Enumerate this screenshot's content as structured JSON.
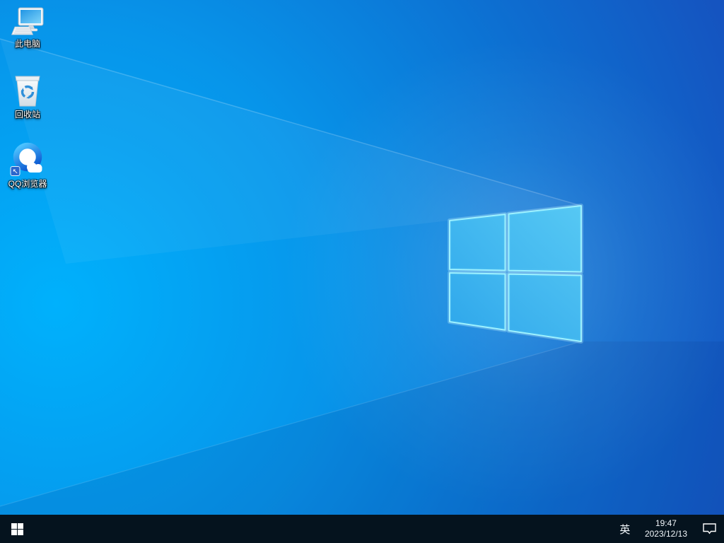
{
  "desktop": {
    "icons": [
      {
        "name": "this-pc",
        "label": "此电脑"
      },
      {
        "name": "recycle-bin",
        "label": "回收站"
      },
      {
        "name": "qq-browser",
        "label": "QQ浏览器"
      }
    ]
  },
  "taskbar": {
    "ime_indicator": "英",
    "clock": {
      "time": "19:47",
      "date": "2023/12/13"
    }
  },
  "colors": {
    "wallpaper_bright": "#00b1fc",
    "wallpaper_deep": "#1a43b5",
    "logo_pane_fill": "#45bdf2",
    "logo_pane_border": "#9ef2ff",
    "taskbar_background": "#05131e",
    "taskbar_text": "#ffffff"
  }
}
